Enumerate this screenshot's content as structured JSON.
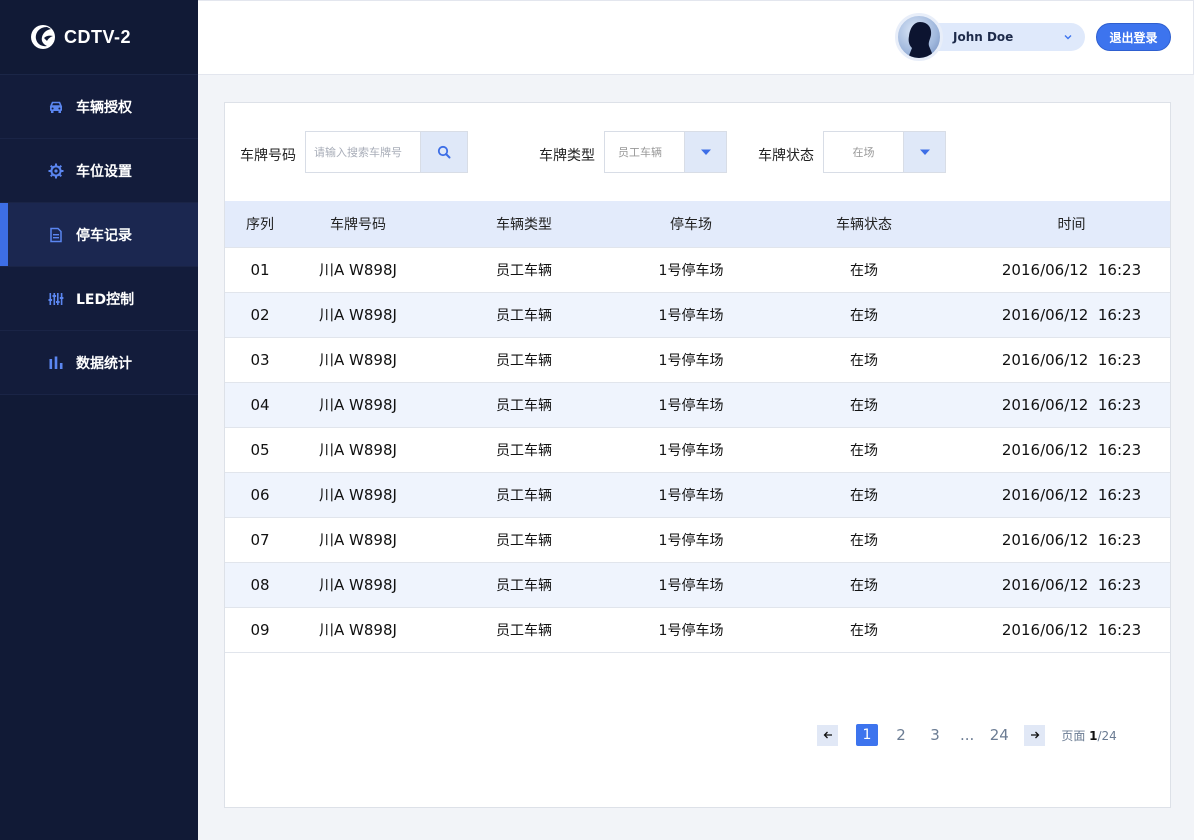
{
  "brand": {
    "name": "CDTV-2"
  },
  "sidebar": {
    "items": [
      {
        "label": "车辆授权",
        "icon": "car-icon"
      },
      {
        "label": "车位设置",
        "icon": "gear-icon"
      },
      {
        "label": "停车记录",
        "icon": "document-icon",
        "active": true
      },
      {
        "label": "LED控制",
        "icon": "sliders-icon"
      },
      {
        "label": "数据统计",
        "icon": "bar-chart-icon"
      }
    ]
  },
  "header": {
    "user_name": "John Doe",
    "logout_label": "退出登录"
  },
  "filters": {
    "plate_label": "车牌号码",
    "plate_placeholder": "请输入搜索车牌号",
    "type_label": "车牌类型",
    "type_value": "员工车辆",
    "status_label": "车牌状态",
    "status_value": "在场"
  },
  "table": {
    "columns": [
      "序列",
      "车牌号码",
      "车辆类型",
      "停车场",
      "车辆状态",
      "时间"
    ],
    "rows": [
      [
        "01",
        "川A W898J",
        "员工车辆",
        "1号停车场",
        "在场",
        "2016/06/12  16:23"
      ],
      [
        "02",
        "川A W898J",
        "员工车辆",
        "1号停车场",
        "在场",
        "2016/06/12  16:23"
      ],
      [
        "03",
        "川A W898J",
        "员工车辆",
        "1号停车场",
        "在场",
        "2016/06/12  16:23"
      ],
      [
        "04",
        "川A W898J",
        "员工车辆",
        "1号停车场",
        "在场",
        "2016/06/12  16:23"
      ],
      [
        "05",
        "川A W898J",
        "员工车辆",
        "1号停车场",
        "在场",
        "2016/06/12  16:23"
      ],
      [
        "06",
        "川A W898J",
        "员工车辆",
        "1号停车场",
        "在场",
        "2016/06/12  16:23"
      ],
      [
        "07",
        "川A W898J",
        "员工车辆",
        "1号停车场",
        "在场",
        "2016/06/12  16:23"
      ],
      [
        "08",
        "川A W898J",
        "员工车辆",
        "1号停车场",
        "在场",
        "2016/06/12  16:23"
      ],
      [
        "09",
        "川A W898J",
        "员工车辆",
        "1号停车场",
        "在场",
        "2016/06/12  16:23"
      ]
    ]
  },
  "pagination": {
    "pages": [
      "1",
      "2",
      "3"
    ],
    "ellipsis": "...",
    "last_page": "24",
    "current": "1",
    "info_prefix": "页面 ",
    "info_current": "1",
    "info_total": "/24"
  },
  "colors": {
    "sidebar_bg": "#111a36",
    "accent": "#3d74ee",
    "row_alt": "#eff4fd",
    "header_row": "#e3ebfb"
  }
}
